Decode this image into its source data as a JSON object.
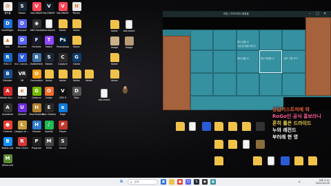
{
  "desktop": {
    "col1": [
      {
        "label": "휴지통",
        "icon": "recycle-bin-icon",
        "color": "#e9ecef",
        "glyph": "♻"
      },
      {
        "label": "DraftSight",
        "icon": "app-icon",
        "color": "#1e6fd9",
        "glyph": "D"
      },
      {
        "label": "VLC",
        "icon": "app-icon",
        "color": "#ffffff",
        "glyph": "▲"
      },
      {
        "label": "RISC-V",
        "icon": "app-icon",
        "color": "#1565c0",
        "glyph": "R"
      },
      {
        "label": "Blender",
        "icon": "app-icon",
        "color": "#1b4d8c",
        "glyph": "B"
      },
      {
        "label": "Adobe Acrobat",
        "icon": "acrobat-icon",
        "color": "#d22b2b",
        "glyph": "A"
      },
      {
        "label": "Autodesk",
        "icon": "app-icon",
        "color": "#333333",
        "glyph": "A"
      },
      {
        "label": "Chrome",
        "icon": "chrome-icon",
        "color": "#e94235",
        "glyph": "●"
      },
      {
        "label": "Battle.net",
        "icon": "app-icon",
        "color": "#148eff",
        "glyph": "B"
      },
      {
        "label": "Minecraft",
        "icon": "app-icon",
        "color": "#5b8a32",
        "glyph": "M"
      }
    ],
    "col2": [
      {
        "label": "Steam",
        "icon": "steam-icon",
        "color": "#1b2838",
        "glyph": "S"
      },
      {
        "label": "Discord",
        "icon": "discord-icon",
        "color": "#5865f2",
        "glyph": "D"
      },
      {
        "label": "Discord",
        "icon": "discord-icon",
        "color": "#5865f2",
        "glyph": "D"
      },
      {
        "label": "VLC Converter",
        "icon": "app-icon",
        "color": "#2a5bd7",
        "glyph": "V"
      },
      {
        "label": "VR",
        "icon": "app-icon",
        "color": "#202020",
        "glyph": "VR"
      },
      {
        "label": "EA app",
        "icon": "app-icon",
        "color": "#f5f5f5",
        "glyph": "e"
      },
      {
        "label": "Ubisoft",
        "icon": "app-icon",
        "color": "#6b2bd8",
        "glyph": "U"
      },
      {
        "label": "League of Legends",
        "icon": "app-icon",
        "color": "#c89b3c",
        "glyph": "L"
      },
      {
        "label": "Riot Client",
        "icon": "app-icon",
        "color": "#d13639",
        "glyph": "R"
      }
    ],
    "col3": [
      {
        "label": "VALORANT",
        "icon": "app-icon",
        "color": "#fd4556",
        "glyph": "V"
      },
      {
        "label": "OBS Studio",
        "icon": "app-icon",
        "color": "#302e31",
        "glyph": "◉"
      },
      {
        "label": "Fortnite",
        "icon": "app-icon",
        "color": "#1a1a2e",
        "glyph": "F"
      },
      {
        "label": "Battlefield",
        "icon": "app-icon",
        "color": "#3a6ea5",
        "glyph": "B"
      },
      {
        "label": "Overwatch",
        "icon": "app-icon",
        "color": "#f99e1a",
        "glyph": "O"
      },
      {
        "label": "Geforce",
        "icon": "app-icon",
        "color": "#76b900",
        "glyph": "G"
      },
      {
        "label": "Hearthstone",
        "icon": "app-icon",
        "color": "#b5812c",
        "glyph": "H"
      },
      {
        "label": "Heroes",
        "icon": "app-icon",
        "color": "#2e7dd1",
        "glyph": "H"
      },
      {
        "label": "Program",
        "icon": "app-icon",
        "color": "#222",
        "glyph": "P"
      }
    ],
    "col4": [
      {
        "label": "VALORANT",
        "icon": "app-icon",
        "color": "#0f1923",
        "glyph": "V"
      },
      {
        "label": "Document",
        "icon": "doc-icon",
        "color": "#f4f4f4",
        "glyph": ""
      },
      {
        "label": "Twitch",
        "icon": "app-icon",
        "color": "#9146ff",
        "glyph": "T"
      },
      {
        "label": "Steam",
        "icon": "steam-icon",
        "color": "#1b2838",
        "glyph": "S"
      },
      {
        "label": "folder",
        "icon": "folder-icon",
        "color": "#f0c24a",
        "glyph": ""
      },
      {
        "label": "Origin",
        "icon": "app-icon",
        "color": "#f56c2d",
        "glyph": "O"
      },
      {
        "label": "Epic Games",
        "icon": "app-icon",
        "color": "#2a2a2a",
        "glyph": "E"
      },
      {
        "label": "Spotify",
        "icon": "app-icon",
        "color": "#1db954",
        "glyph": "♪"
      },
      {
        "label": "MOD",
        "icon": "app-icon",
        "color": "#444",
        "glyph": "M"
      }
    ],
    "col5": [
      {
        "label": "VALORANT",
        "icon": "app-icon",
        "color": "#fd4556",
        "glyph": "V"
      },
      {
        "label": "folder",
        "icon": "folder-icon",
        "color": "#f0c24a",
        "glyph": ""
      },
      {
        "label": "Photoshop",
        "icon": "app-icon",
        "color": "#001e36",
        "glyph": "Ps"
      },
      {
        "label": "Capture",
        "icon": "app-icon",
        "color": "#2d2d2d",
        "glyph": "C"
      },
      {
        "label": "folder",
        "icon": "folder-icon",
        "color": "#f0c24a",
        "glyph": ""
      },
      {
        "label": "GTA V",
        "icon": "app-icon",
        "color": "#111",
        "glyph": "V"
      },
      {
        "label": "Edge",
        "icon": "app-icon",
        "color": "#0f7ad8",
        "glyph": "e"
      },
      {
        "label": "Player",
        "icon": "app-icon",
        "color": "#c0392b",
        "glyph": "P"
      },
      {
        "label": "Sound",
        "icon": "app-icon",
        "color": "#333",
        "glyph": "S"
      }
    ],
    "col6": [
      {
        "label": "Nexon",
        "icon": "app-icon",
        "color": "#e8e8e8",
        "glyph": "N"
      },
      {
        "label": "folder",
        "icon": "folder-icon",
        "color": "#f0c24a",
        "glyph": ""
      },
      {
        "label": "folder",
        "icon": "folder-icon",
        "color": "#f0c24a",
        "glyph": ""
      },
      {
        "label": "Game",
        "icon": "app-icon",
        "color": "#0e3b6b",
        "glyph": "G"
      },
      {
        "label": "folder",
        "icon": "folder-icon",
        "color": "#f0c24a",
        "glyph": ""
      },
      {
        "label": "Disc",
        "icon": "app-icon",
        "color": "#555",
        "glyph": "D"
      }
    ],
    "mid_icons": [
      {
        "label": "folder",
        "icon": "folder-icon",
        "color": "#f0c24a"
      },
      {
        "label": "document",
        "icon": "doc-icon",
        "color": "#f4f4f4"
      },
      {
        "label": "image",
        "icon": "image-icon",
        "color": "#c9b28a"
      },
      {
        "label": "image",
        "icon": "image-icon",
        "color": "#b89c78"
      },
      {
        "label": "folder",
        "icon": "folder-icon",
        "color": "#f0c24a"
      },
      {
        "label": "folder",
        "icon": "folder-icon",
        "color": "#f0c24a"
      },
      {
        "label": "folder",
        "icon": "folder-icon",
        "color": "#f0c24a"
      },
      {
        "label": "document",
        "icon": "doc-icon",
        "color": "#f4f4f4"
      }
    ]
  },
  "window": {
    "title": "리듬 | 아이다에서 몸통을",
    "controls": [
      "–",
      "□",
      "✕"
    ],
    "tiles_text": {
      "t1": "경사 상황 나",
      "t2": "지금 끝 맞춰 보는지",
      "t3": "최신 버전을 나",
      "t4": "경사 상황 나",
      "t5": "빌드 기준 보기"
    }
  },
  "chat": {
    "lines": [
      {
        "text": "상급커스트마에 와",
        "color": "#e8643c"
      },
      {
        "text": "RoGo인 공식 홍보라니",
        "color": "#ff5b9c"
      },
      {
        "text": "흔히 틀은 드라이드",
        "color": "#f2d84c"
      },
      {
        "text": "누와 레전드",
        "color": "#ffffff"
      },
      {
        "text": "부러래 현 영",
        "color": "#ffffff"
      }
    ]
  },
  "taskbar": {
    "search_placeholder": "검색",
    "tray_time": "오후 3:41",
    "tray_date": "2024-03-09",
    "lang": "A"
  }
}
